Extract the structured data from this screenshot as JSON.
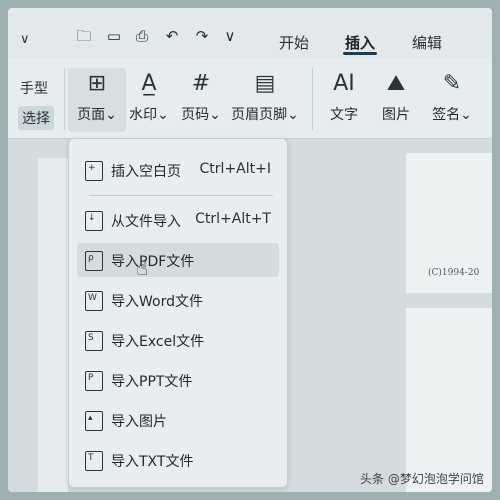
{
  "topbar": {
    "dropdown_chevron": "∨",
    "quick_icons": [
      "folder-icon",
      "save-icon",
      "print-icon",
      "undo-icon",
      "redo-icon",
      "more-icon"
    ],
    "tabs": [
      {
        "label": "开始",
        "active": false
      },
      {
        "label": "插入",
        "active": true
      },
      {
        "label": "编辑",
        "active": false
      }
    ]
  },
  "ribbon": {
    "partial_labels": [
      "手型",
      "选择"
    ],
    "buttons": [
      {
        "label": "页面",
        "dropdown": true
      },
      {
        "label": "水印",
        "dropdown": true
      },
      {
        "label": "页码",
        "dropdown": true
      },
      {
        "label": "页眉页脚",
        "dropdown": true
      },
      {
        "label": "文字",
        "dropdown": false
      },
      {
        "label": "图片",
        "dropdown": false
      },
      {
        "label": "签名",
        "dropdown": true
      }
    ]
  },
  "menu": {
    "items": [
      {
        "label": "插入空白页",
        "shortcut": "Ctrl+Alt+I",
        "icon": "blank-page-icon"
      },
      {
        "label": "从文件导入",
        "shortcut": "Ctrl+Alt+T",
        "icon": "import-file-icon"
      },
      {
        "label": "导入PDF文件",
        "shortcut": "",
        "icon": "pdf-file-icon"
      },
      {
        "label": "导入Word文件",
        "shortcut": "",
        "icon": "word-file-icon"
      },
      {
        "label": "导入Excel文件",
        "shortcut": "",
        "icon": "excel-file-icon"
      },
      {
        "label": "导入PPT文件",
        "shortcut": "",
        "icon": "ppt-file-icon"
      },
      {
        "label": "导入图片",
        "shortcut": "",
        "icon": "image-file-icon"
      },
      {
        "label": "导入TXT文件",
        "shortcut": "",
        "icon": "txt-file-icon"
      }
    ]
  },
  "document": {
    "copyright": "(C)1994-20"
  },
  "watermark": "头条 @梦幻泡泡学问馆",
  "colors": {
    "accent": "#1f3d4e",
    "menu_bg": "#e8eef0",
    "hover": "#d3dde0"
  }
}
